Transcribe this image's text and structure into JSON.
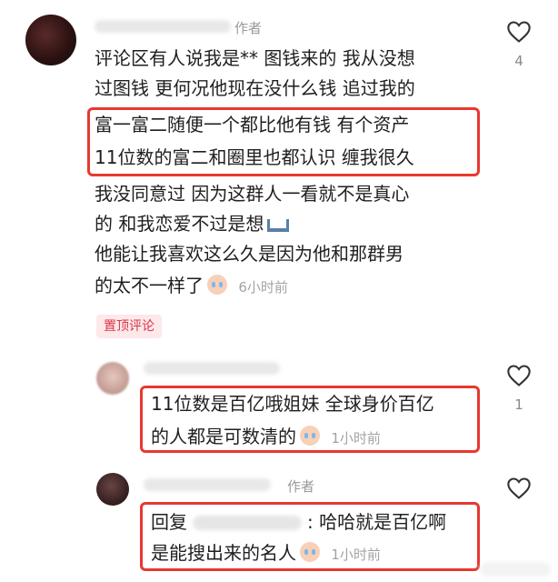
{
  "comment_main": {
    "author_tag": "作者",
    "lines": [
      "评论区有人说我是** 图钱来的 我从没想",
      "过图钱 更何况他现在没什么钱 追过我的",
      "富一富二随便一个都比他有钱 有个资产",
      "11位数的富二和圈里也都认识 缠我很久",
      "我没同意过 因为这群人一看就不是真心",
      "的 和我恋爱不过是想",
      "他能让我喜欢这么久是因为他和那群男",
      "的太不一样了"
    ],
    "time": "6小时前",
    "like_count": "4",
    "pinned_label": "置顶评论"
  },
  "reply_1": {
    "lines": [
      "11位数是百亿哦姐妹 全球身价百亿",
      "的人都是可数清的"
    ],
    "time": "1小时前",
    "like_count": "1"
  },
  "reply_2": {
    "author_tag": "作者",
    "line1_prefix": "回复",
    "line1_suffix": ": 哈哈就是百亿啊",
    "line2": "是能搜出来的名人",
    "time": "1小时前"
  },
  "colors": {
    "highlight_box": "#e8382f",
    "pinned_bg": "#fde8ea",
    "pinned_text": "#d9364a"
  }
}
